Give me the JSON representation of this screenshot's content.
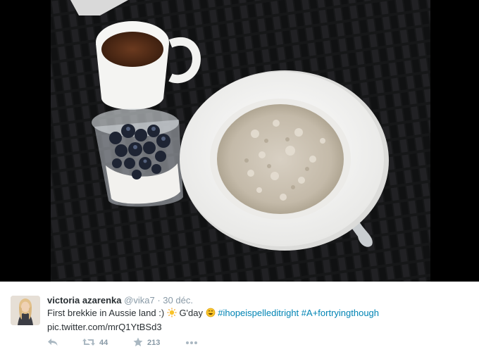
{
  "tweet": {
    "user_name": "victoria azarenka",
    "handle": "@vika7",
    "separator": "·",
    "date": "30 déc.",
    "text_part1": "First brekkie in Aussie land :)",
    "text_part2": "G'day",
    "hashtag1": "#ihopeispelleditright",
    "hashtag2": "#A+fortryingthough",
    "link": "pic.twitter.com/mrQ1YtBSd3"
  },
  "actions": {
    "retweet_count": "44",
    "favorite_count": "213"
  },
  "icons": [
    "reply-icon",
    "retweet-icon",
    "favorite-icon",
    "more-icon",
    "sun-emoji-icon",
    "smile-emoji-icon"
  ],
  "colors": {
    "link": "#0084b4",
    "name": "#292f33",
    "muted": "#8899a6",
    "image_background": "#000000"
  }
}
